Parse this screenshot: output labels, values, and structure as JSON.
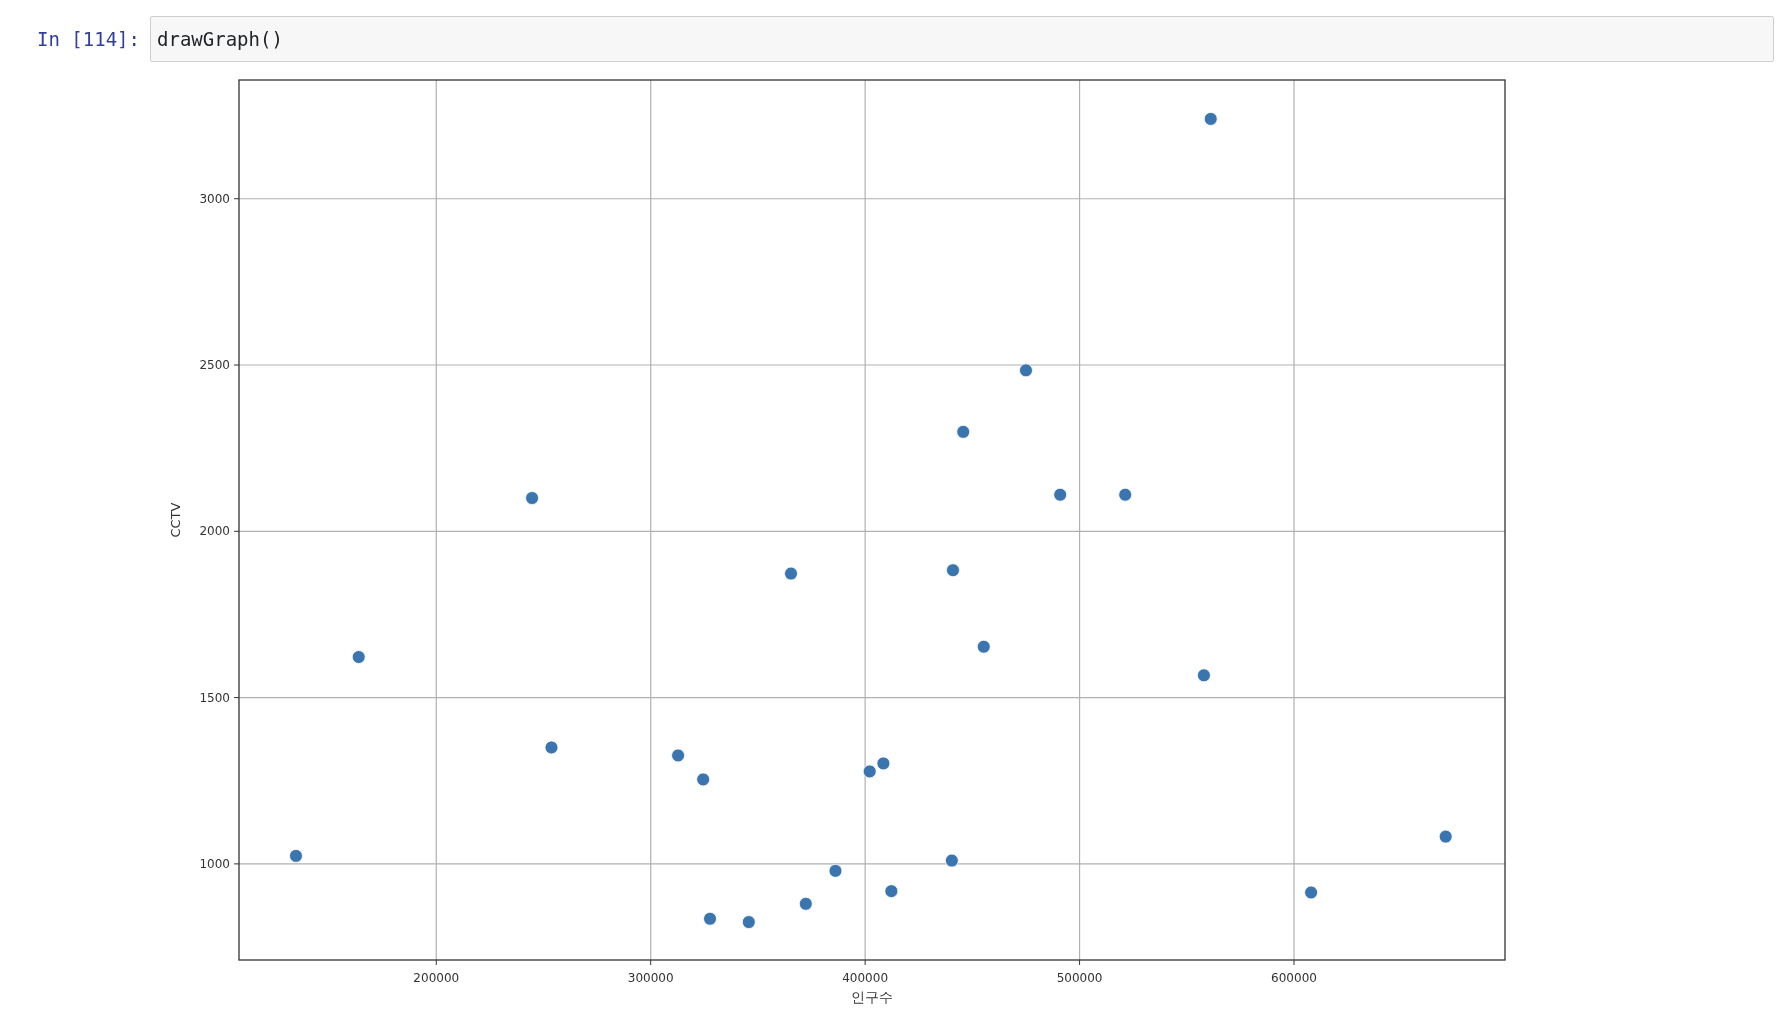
{
  "cell": {
    "prompt": "In [114]:",
    "code": "drawGraph()"
  },
  "output": {
    "chart_data": {
      "type": "scatter",
      "xlabel": "인구수",
      "ylabel": "CCTV",
      "x": [
        561170,
        475000,
        445745,
        490960,
        521280,
        244680,
        365430,
        440960,
        455320,
        163830,
        557980,
        253720,
        312770,
        408510,
        324470,
        402130,
        134570,
        440430,
        670740,
        386170,
        412230,
        607980,
        372340,
        327660,
        345740
      ],
      "series": [
        {
          "color": "#3a75b0",
          "values": [
            3240,
            2484,
            2299,
            2110,
            2110,
            2100,
            1873,
            1883,
            1653,
            1622,
            1567,
            1350,
            1326,
            1302,
            1254,
            1278,
            1024,
            1010,
            1082,
            979,
            918,
            914,
            880,
            835,
            825
          ]
        }
      ],
      "xlim": [
        108000,
        698400
      ],
      "ylim": [
        711,
        3357
      ],
      "xticks": [
        200000,
        300000,
        400000,
        500000,
        600000
      ],
      "yticks": [
        1000,
        1500,
        2000,
        2500,
        3000
      ],
      "grid": true
    }
  }
}
